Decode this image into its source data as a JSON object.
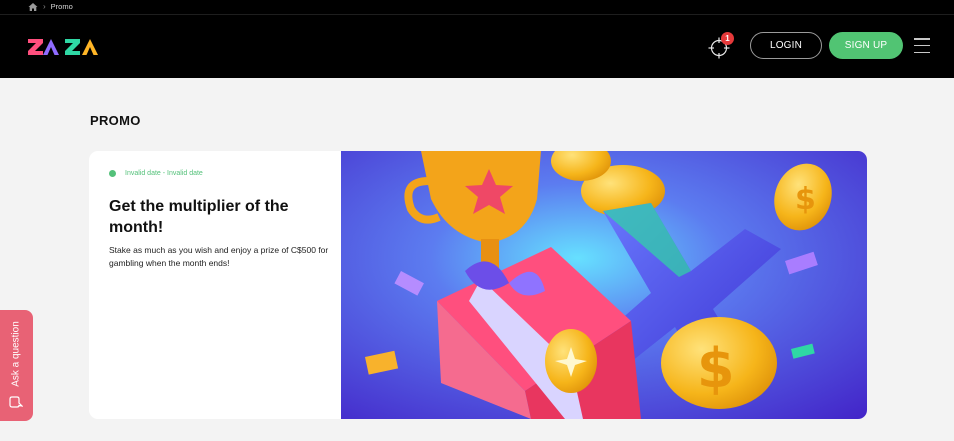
{
  "breadcrumb": {
    "items": [
      "Promo"
    ]
  },
  "header": {
    "logo_text": "ZAZA",
    "notifications_count": "1",
    "login_label": "LOGIN",
    "signup_label": "SIGN UP"
  },
  "main": {
    "page_title": "PROMO",
    "promo": {
      "date": "Invalid date - Invalid date",
      "title": "Get the multiplier of the month!",
      "description": "Stake as much as you wish and enjoy a prize of C$500 for gambling when the month ends!"
    }
  },
  "support": {
    "ask_label": "Ask a question"
  },
  "icons": {
    "home": "home-icon",
    "breadcrumb_separator": "chevron-right-icon",
    "notifications": "crosshair-icon",
    "menu": "hamburger-menu-icon",
    "chat": "chat-bubble-icon"
  },
  "colors": {
    "header_bg": "#000000",
    "page_bg": "#f3f3f3",
    "accent_green": "#51c473",
    "badge_red": "#e5393a",
    "ask_button": "#e86275",
    "promo_bg": "#4a35d8"
  }
}
